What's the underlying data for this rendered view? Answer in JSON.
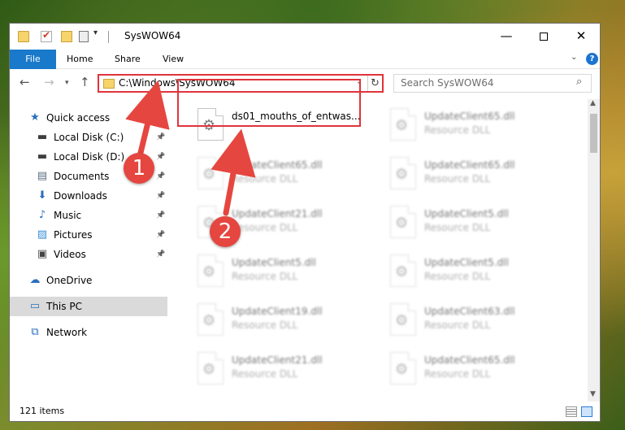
{
  "window": {
    "title": "SysWOW64",
    "minimize": "—",
    "close": "✕"
  },
  "ribbon": {
    "file": "File",
    "home": "Home",
    "share": "Share",
    "view": "View",
    "help": "?"
  },
  "navigation": {
    "back": "←",
    "forward": "→",
    "recent": "▾",
    "up": "↑",
    "address": "C:\\Windows\\SysWOW64",
    "refresh": "↻",
    "search_placeholder": "Search SysWOW64"
  },
  "sidebar": {
    "items": [
      {
        "label": "Quick access",
        "icon": "star-icon",
        "glyph": "★",
        "color": "#2a6ebd"
      },
      {
        "label": "Local Disk (C:)",
        "icon": "drive-icon",
        "glyph": "▬",
        "color": "#3d3d3d",
        "pinned": true
      },
      {
        "label": "Local Disk (D:)",
        "icon": "drive-icon",
        "glyph": "▬",
        "color": "#3d3d3d",
        "pinned": true
      },
      {
        "label": "Documents",
        "icon": "documents-icon",
        "glyph": "▤",
        "color": "#5a6c80",
        "pinned": true
      },
      {
        "label": "Downloads",
        "icon": "download-icon",
        "glyph": "⬇",
        "color": "#2a6ebd",
        "pinned": true
      },
      {
        "label": "Music",
        "icon": "music-icon",
        "glyph": "♪",
        "color": "#2a6ebd",
        "pinned": true
      },
      {
        "label": "Pictures",
        "icon": "pictures-icon",
        "glyph": "▨",
        "color": "#3a8fd6",
        "pinned": true
      },
      {
        "label": "Videos",
        "icon": "videos-icon",
        "glyph": "▣",
        "color": "#444444",
        "pinned": true
      },
      {
        "label": "OneDrive",
        "icon": "cloud-icon",
        "glyph": "☁",
        "color": "#2a6ebd"
      },
      {
        "label": "This PC",
        "icon": "computer-icon",
        "glyph": "▭",
        "color": "#2a6ebd",
        "selected": true
      },
      {
        "label": "Network",
        "icon": "network-icon",
        "glyph": "⧉",
        "color": "#2a6ebd"
      }
    ]
  },
  "files": [
    {
      "name": "ds01_mouths_of_entwas...",
      "type": "",
      "highlighted": true
    },
    {
      "name": "UpdateClient65.dll",
      "type": "Resource DLL"
    },
    {
      "name": "UpdateClient65.dll",
      "type": "Resource DLL"
    },
    {
      "name": "UpdateClient65.dll",
      "type": "Resource DLL"
    },
    {
      "name": "UpdateClient21.dll",
      "type": "Resource DLL"
    },
    {
      "name": "UpdateClient5.dll",
      "type": "Resource DLL"
    },
    {
      "name": "UpdateClient5.dll",
      "type": "Resource DLL"
    },
    {
      "name": "UpdateClient5.dll",
      "type": "Resource DLL"
    },
    {
      "name": "UpdateClient19.dll",
      "type": "Resource DLL"
    },
    {
      "name": "UpdateClient63.dll",
      "type": "Resource DLL"
    },
    {
      "name": "UpdateClient21.dll",
      "type": "Resource DLL"
    },
    {
      "name": "UpdateClient65.dll",
      "type": "Resource DLL"
    }
  ],
  "status": {
    "item_count": "121 items"
  },
  "callouts": {
    "first": "1",
    "second": "2"
  },
  "colors": {
    "accent": "#1979ca",
    "highlight_red": "#e0343a",
    "callout_red": "#e5463f"
  }
}
